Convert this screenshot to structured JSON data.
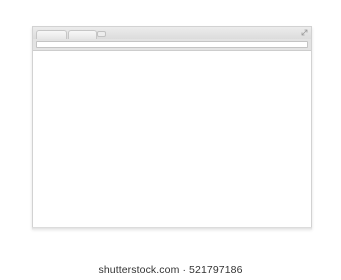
{
  "browser": {
    "tabs": [
      {
        "label": ""
      },
      {
        "label": ""
      }
    ],
    "address_bar": {
      "value": "",
      "placeholder": ""
    },
    "icons": {
      "new_tab": "new-tab-icon",
      "resize": "resize-arrows-icon"
    }
  },
  "colors": {
    "frame": "#dcdcdc",
    "content": "#ffffff"
  },
  "watermark": {
    "text": "shutterstock.com · 521797186"
  }
}
